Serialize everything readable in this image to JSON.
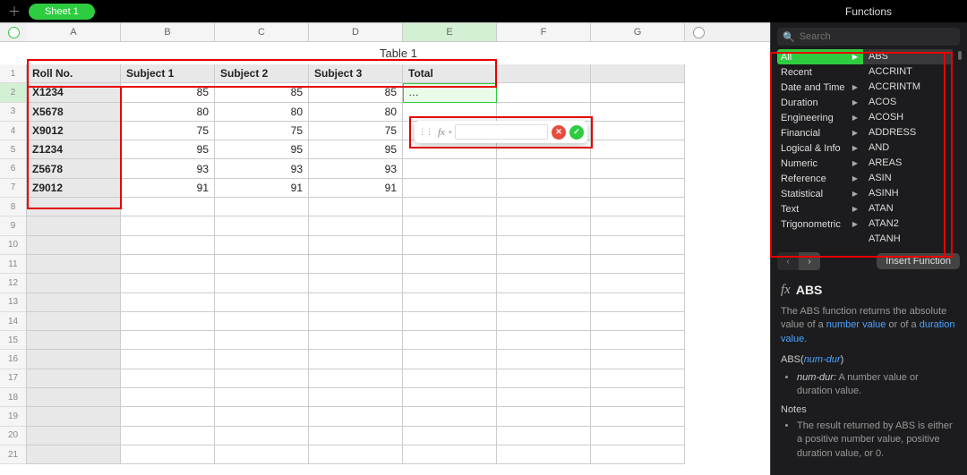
{
  "tabbar": {
    "sheet_label": "Sheet 1"
  },
  "columns": [
    "A",
    "B",
    "C",
    "D",
    "E",
    "F",
    "G"
  ],
  "selected_col_idx": 4,
  "table_title": "Table 1",
  "headers": [
    "Roll No.",
    "Subject 1",
    "Subject 2",
    "Subject 3",
    "Total"
  ],
  "rows": [
    {
      "n": 1
    },
    {
      "n": 2,
      "name": "X1234",
      "s1": 85,
      "s2": 85,
      "s3": 85,
      "total": "…"
    },
    {
      "n": 3,
      "name": "X5678",
      "s1": 80,
      "s2": 80,
      "s3": 80
    },
    {
      "n": 4,
      "name": "X9012",
      "s1": 75,
      "s2": 75,
      "s3": 75
    },
    {
      "n": 5,
      "name": "Z1234",
      "s1": 95,
      "s2": 95,
      "s3": 95
    },
    {
      "n": 6,
      "name": "Z5678",
      "s1": 93,
      "s2": 93,
      "s3": 93
    },
    {
      "n": 7,
      "name": "Z9012",
      "s1": 91,
      "s2": 91,
      "s3": 91
    }
  ],
  "empty_row_count": 14,
  "formula_popup": {
    "fx_label": "fx",
    "chev": "▾"
  },
  "sidebar": {
    "title": "Functions",
    "search_placeholder": "Search",
    "categories": [
      "All",
      "Recent",
      "Date and Time",
      "Duration",
      "Engineering",
      "Financial",
      "Logical & Info",
      "Numeric",
      "Reference",
      "Statistical",
      "Text",
      "Trigonometric"
    ],
    "selected_category_idx": 0,
    "functions": [
      "ABS",
      "ACCRINT",
      "ACCRINTM",
      "ACOS",
      "ACOSH",
      "ADDRESS",
      "AND",
      "AREAS",
      "ASIN",
      "ASINH",
      "ATAN",
      "ATAN2",
      "ATANH"
    ],
    "selected_function_idx": 0,
    "insert_label": "Insert Function",
    "desc": {
      "name": "ABS",
      "summary_pre": "The ABS function returns the absolute value of a ",
      "summary_link1": "number value",
      "summary_mid": " or of a ",
      "summary_link2": "duration value",
      "summary_post": ".",
      "signature": "ABS",
      "sig_arg": "num-dur",
      "arg_desc_label_pre": "num-dur:",
      "arg_desc": " A number value or duration value.",
      "notes_h": "Notes",
      "note1": "The result returned by ABS is either a positive number value, positive duration value, or 0."
    }
  }
}
